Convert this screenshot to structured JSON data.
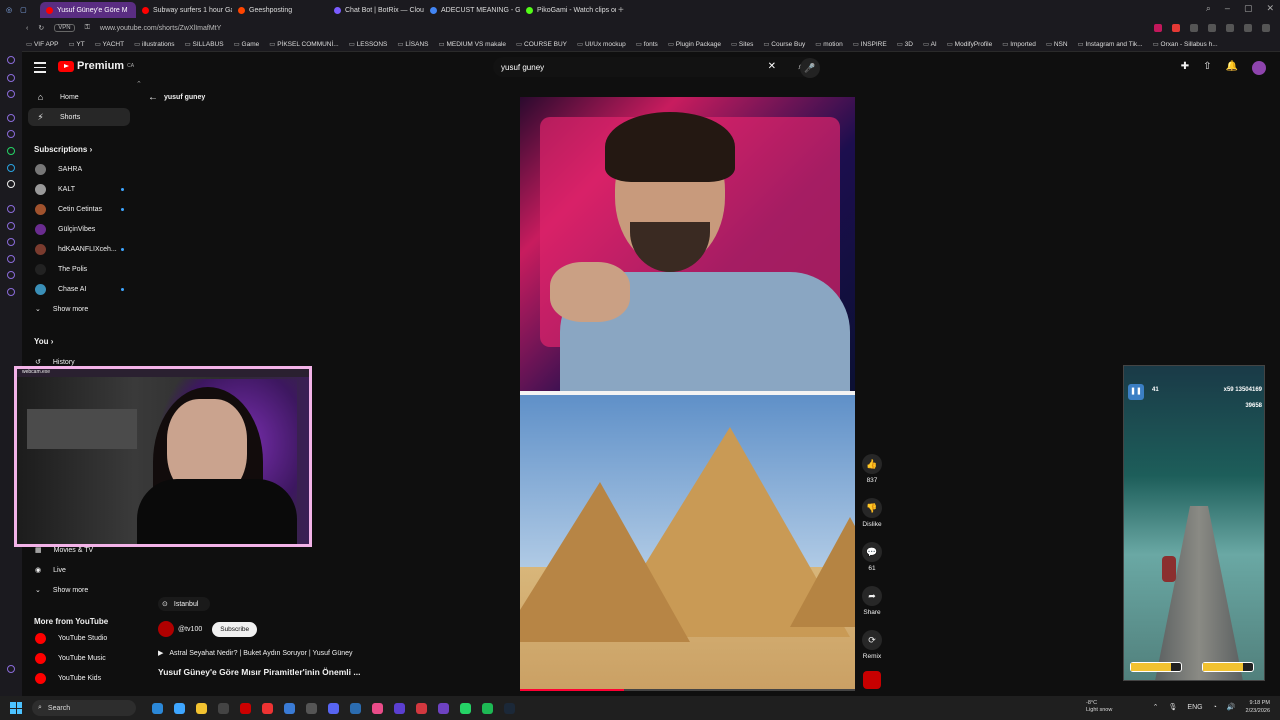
{
  "browser": {
    "tabs": [
      {
        "label": "Yusuf Güney'e Göre M",
        "color": "#ff0000",
        "active": true
      },
      {
        "label": "Subway surfers 1 hour Ga",
        "color": "#ff0000"
      },
      {
        "label": "Geeshposting",
        "color": "#ff4500"
      },
      {
        "label": "Chat Bot | BotRix — Clou",
        "color": "#7b5cff"
      },
      {
        "label": "ADECUST MEANING - Go",
        "color": "#4285f4"
      },
      {
        "label": "PikoGami - Watch clips or",
        "color": "#53fc18"
      }
    ],
    "new_tab": "+",
    "url": "www.youtube.com/shorts/ZwXlImafMtY",
    "vpn": "VPN",
    "bookmarks": [
      "VIF APP",
      "YT",
      "YACHT",
      "illustrations",
      "SILLABUS",
      "Game",
      "PİKSEL COMMUNİ...",
      "LESSONS",
      "LİSANS",
      "MEDIUM VS makale",
      "COURSE BUY",
      "UI/Ux mockup",
      "fonts",
      "Plugin Package",
      "Sites",
      "Course Buy",
      "motion",
      "INSPIRE",
      "3D",
      "AI",
      "ModifyProfile",
      "Imported",
      "NSN",
      "Instagram and Tik...",
      "Orxan - Sillabus h..."
    ]
  },
  "header": {
    "logo": "Premium",
    "logo_region": "CA",
    "search_query": "yusuf guney"
  },
  "sidebar": {
    "main": [
      {
        "label": "Home",
        "icon": "⌂"
      },
      {
        "label": "Shorts",
        "icon": "⚡",
        "active": true
      }
    ],
    "subscriptions_title": "Subscriptions",
    "subscriptions": [
      {
        "label": "SAHRA",
        "color": "#777"
      },
      {
        "label": "KALT",
        "color": "#999",
        "dot": true
      },
      {
        "label": "Cetin Cetintas",
        "color": "#a0522d",
        "dot": true
      },
      {
        "label": "GülçinVibes",
        "color": "#6a2c8f"
      },
      {
        "label": "hdKAANFLIXceh...",
        "color": "#7a3b2e",
        "dot": true
      },
      {
        "label": "The Polis",
        "color": "#222"
      },
      {
        "label": "Chase AI",
        "color": "#3a8fb7",
        "dot": true
      }
    ],
    "show_more": "Show more",
    "you_title": "You",
    "history": "History",
    "explore": [
      {
        "label": "Movies & TV",
        "icon": "▦"
      },
      {
        "label": "Live",
        "icon": "◉"
      }
    ],
    "show_more_2": "Show more",
    "more_title": "More from YouTube",
    "more": [
      "YouTube Studio",
      "YouTube Music",
      "YouTube Kids"
    ]
  },
  "shorts": {
    "back_query": "yusuf guney",
    "location": "Istanbul",
    "channel": "@tv100",
    "subscribe": "Subscribe",
    "music": "Astral Seyahat Nedir? | Buket Aydın Soruyor | Yusuf Güney",
    "title": "Yusuf Güney'e Göre Mısır Piramitler'inin Önemli ...",
    "progress": 0.31,
    "actions": [
      {
        "name": "like",
        "icon": "👍",
        "label": "837"
      },
      {
        "name": "dislike",
        "icon": "👎",
        "label": "Dislike"
      },
      {
        "name": "comments",
        "icon": "💬",
        "label": "61"
      },
      {
        "name": "share",
        "icon": "➦",
        "label": "Share"
      },
      {
        "name": "remix",
        "icon": "⟳",
        "label": "Remix"
      }
    ]
  },
  "webcam": {
    "label": "webcam.exe"
  },
  "game": {
    "coins": "41",
    "multiplier": "x59",
    "score": "13504169",
    "sub_score": "39658"
  },
  "taskbar": {
    "search_placeholder": "Search",
    "apps": [
      "#2b88d8",
      "#3ea6ff",
      "#f2c230",
      "#444",
      "#c00",
      "#e33",
      "#3a7bd5",
      "#555",
      "#5865f2",
      "#2b6cb0",
      "#ea4c89",
      "#5b3fd1",
      "#d3383f",
      "#6e42c1",
      "#25d366",
      "#1db954",
      "#1b2838"
    ],
    "weather_temp": "-8°C",
    "weather_desc": "Light snow",
    "lang": "ENG",
    "time": "9:18 PM",
    "date": "2/23/2026"
  }
}
